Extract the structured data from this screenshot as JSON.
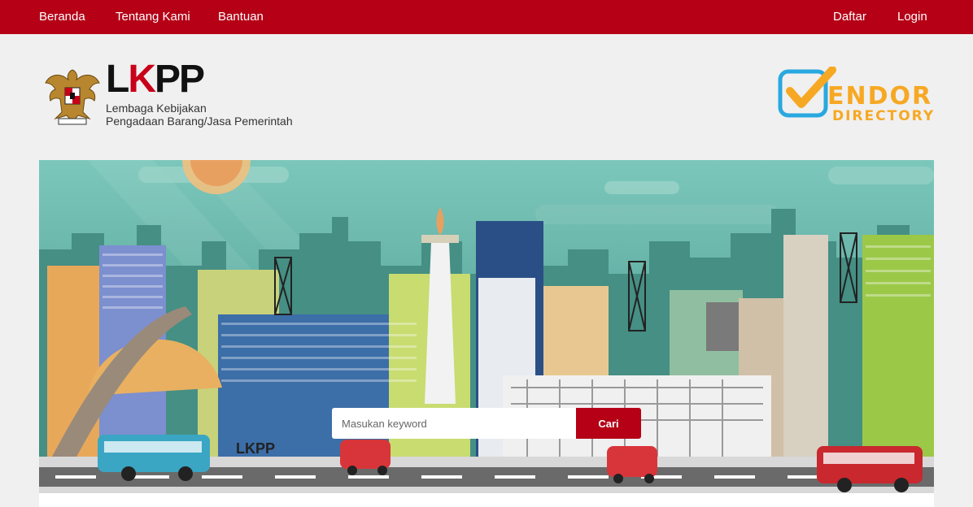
{
  "nav": {
    "left": [
      {
        "label": "Beranda"
      },
      {
        "label": "Tentang Kami"
      },
      {
        "label": "Bantuan"
      }
    ],
    "right": [
      {
        "label": "Daftar"
      },
      {
        "label": "Login"
      }
    ]
  },
  "header": {
    "logo_wordmark_l": "L",
    "logo_wordmark_k": "K",
    "logo_wordmark_pp": "PP",
    "logo_line1": "Lembaga Kebijakan",
    "logo_line2": "Pengadaan Barang/Jasa Pemerintah",
    "vendor_word": "ENDOR",
    "vendor_sub": "DIRECTORY"
  },
  "banner": {
    "sign_text": "LKPP"
  },
  "search": {
    "placeholder": "Masukan keyword",
    "value": "",
    "button_label": "Cari"
  },
  "colors": {
    "primary": "#b50016",
    "vendor_orange": "#f7a823",
    "vendor_blue": "#29a8e0",
    "sky": "#4f9e94"
  }
}
